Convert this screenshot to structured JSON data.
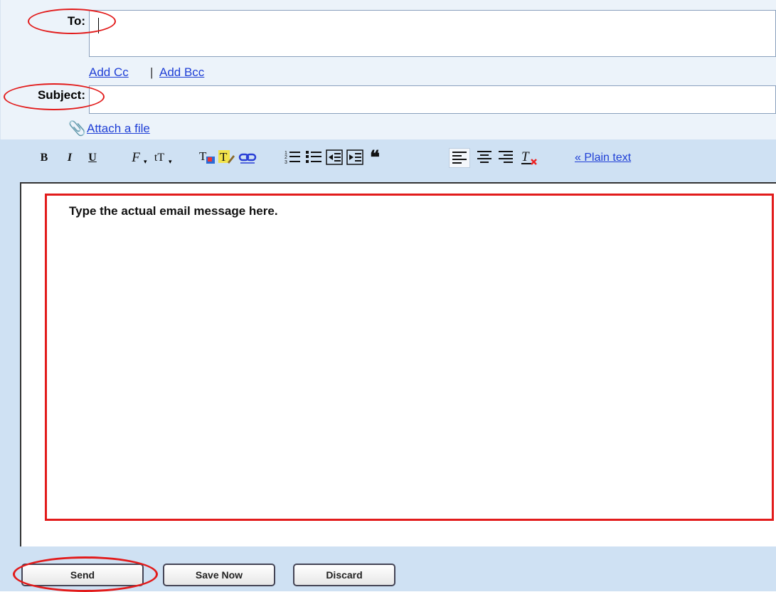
{
  "compose": {
    "to_label": "To:",
    "to_value": "",
    "add_cc": "Add Cc",
    "separator": "|",
    "add_bcc": "Add Bcc",
    "subject_label": "Subject:",
    "subject_value": "",
    "attach_label": "Attach a file"
  },
  "toolbar": {
    "bold": "B",
    "italic": "I",
    "underline": "U",
    "font": "F",
    "size": "tT",
    "plain_text": "« Plain text"
  },
  "editor": {
    "message": "Type the actual email message here."
  },
  "actions": {
    "send": "Send",
    "save_now": "Save Now",
    "discard": "Discard"
  },
  "colors": {
    "header_bg": "#ecf3fa",
    "toolbar_bg": "#cfe1f3",
    "link": "#1f3fd6",
    "annotation": "#e21b1b"
  },
  "icons": [
    "paperclip-icon",
    "text-color-icon",
    "highlight-icon",
    "link-icon",
    "numbered-list-icon",
    "bulleted-list-icon",
    "indent-less-icon",
    "indent-more-icon",
    "quote-icon",
    "align-left-icon",
    "align-center-icon",
    "align-right-icon",
    "remove-formatting-icon"
  ]
}
